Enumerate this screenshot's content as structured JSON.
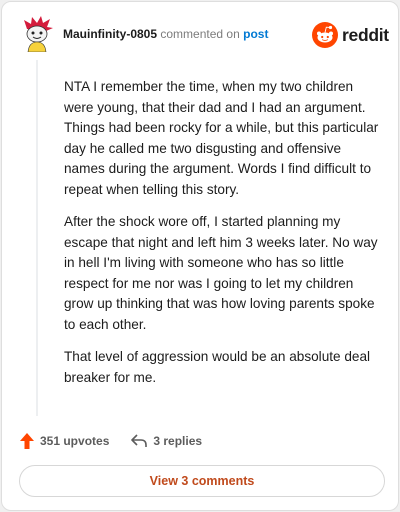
{
  "comment": {
    "username": "Mauinfinity-0805",
    "action_text": "commented on",
    "target_text": "post",
    "paragraphs": [
      "NTA I remember the time, when my two children were young, that their dad and I had an argument. Things had been rocky for a while, but this particular day he called me two disgusting and offensive names during the argument. Words I find difficult to repeat when telling this story.",
      "After the shock wore off, I started planning my escape that night and left him 3 weeks later. No way in hell I'm living with someone who has so little respect for me nor was I going to let my children grow up thinking that was how loving parents spoke to each other.",
      "That level of aggression would be an absolute deal breaker for me."
    ]
  },
  "branding": {
    "logo_text": "reddit",
    "accent": "#ff4500"
  },
  "footer": {
    "upvotes_label": "351 upvotes",
    "replies_label": "3 replies",
    "view_comments_label": "View 3 comments"
  },
  "icons": {
    "avatar": "avatar",
    "logo": "reddit-logo-icon",
    "upvote": "upvote-arrow-icon",
    "reply": "reply-arrow-icon"
  },
  "colors": {
    "username": "#1c1c1c",
    "link": "#0079d3",
    "upvote": "#ff4500",
    "button_text": "#c04a1c"
  }
}
